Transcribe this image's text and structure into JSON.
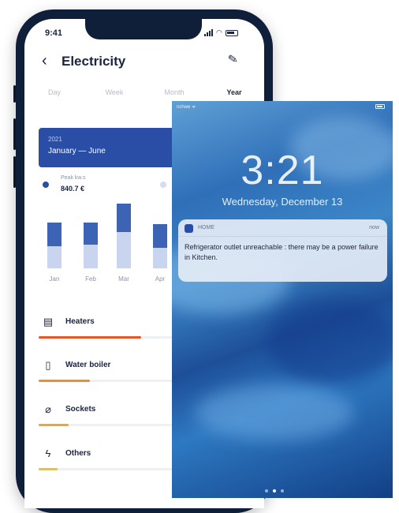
{
  "status_bar": {
    "time": "9:41"
  },
  "header": {
    "back_icon": "chevron-left-icon",
    "title": "Electricity",
    "edit_icon": "pencil-icon"
  },
  "tabs": [
    {
      "label": "Day",
      "active": false
    },
    {
      "label": "Week",
      "active": false
    },
    {
      "label": "Month",
      "active": false
    },
    {
      "label": "Year",
      "active": true
    }
  ],
  "period": {
    "year": "2021",
    "range": "January — June"
  },
  "summary": {
    "label": "Peak kw.s",
    "value": "840.7 €"
  },
  "chart_data": {
    "type": "bar",
    "stacked": true,
    "categories": [
      "Jan",
      "Feb",
      "Mar",
      "Apr"
    ],
    "series": [
      {
        "values": [
          28,
          30,
          46,
          26
        ]
      },
      {
        "values": [
          30,
          28,
          36,
          30
        ]
      }
    ],
    "colors": [
      "#c9d5ef",
      "#3d63b5"
    ],
    "ylim": [
      0,
      90
    ]
  },
  "categories": [
    {
      "label": "Heaters",
      "icon": "heater-icon",
      "share": 0.48,
      "color": "#e8552b"
    },
    {
      "label": "Water boiler",
      "icon": "water-boiler-icon",
      "share": 0.24,
      "color": "#f28c28"
    },
    {
      "label": "Sockets",
      "icon": "socket-icon",
      "share": 0.14,
      "color": "#f5a524"
    },
    {
      "label": "Others",
      "icon": "bolt-icon",
      "share": 0.09,
      "color": "#f6c21c"
    }
  ],
  "lock_screen": {
    "carrier": "nchwe ᯤ",
    "time": "3:21",
    "date": "Wednesday, December 13",
    "notification": {
      "app": "HOME",
      "when": "now",
      "message": "Refrigerator outlet unreachable : there may be a power failure in Kitchen."
    }
  }
}
